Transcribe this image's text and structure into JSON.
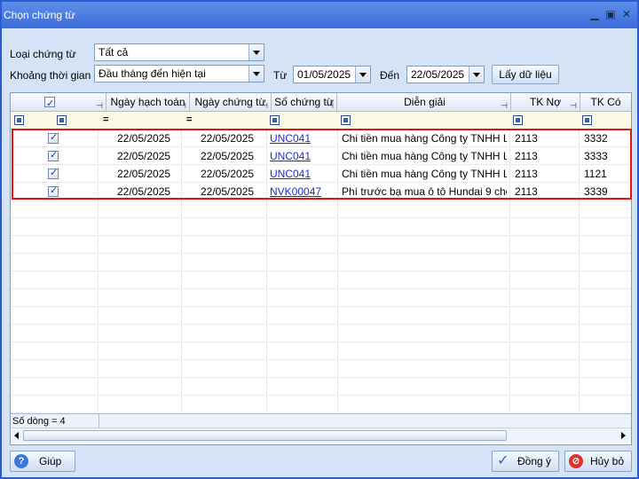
{
  "window": {
    "title": "Chọn chứng từ"
  },
  "filters": {
    "doc_type_label": "Loại chứng từ",
    "doc_type_value": "Tất cả",
    "period_label": "Khoảng thời gian",
    "period_value": "Đầu tháng đến hiện tại",
    "from_label": "Từ",
    "from_value": "01/05/2025",
    "to_label": "Đến",
    "to_value": "22/05/2025",
    "fetch_label": "Lấy dữ liệu"
  },
  "grid": {
    "columns": [
      "Ngày hạch toán",
      "Ngày chứng từ",
      "Số chứng từ",
      "Diễn giải",
      "TK Nợ",
      "TK Có"
    ],
    "rows": [
      {
        "checked": true,
        "posting_date": "22/05/2025",
        "doc_date": "22/05/2025",
        "doc_no": "UNC041",
        "description": "Chi tiền mua hàng Công ty TNHH L...",
        "debit": "2113",
        "credit": "3332"
      },
      {
        "checked": true,
        "posting_date": "22/05/2025",
        "doc_date": "22/05/2025",
        "doc_no": "UNC041",
        "description": "Chi tiền mua hàng Công ty TNHH L...",
        "debit": "2113",
        "credit": "3333"
      },
      {
        "checked": true,
        "posting_date": "22/05/2025",
        "doc_date": "22/05/2025",
        "doc_no": "UNC041",
        "description": "Chi tiền mua hàng Công ty TNHH L...",
        "debit": "2113",
        "credit": "1121"
      },
      {
        "checked": true,
        "posting_date": "22/05/2025",
        "doc_date": "22/05/2025",
        "doc_no": "NVK00047",
        "description": "Phí trước bạ mua ô tô Hundai 9 chỗ",
        "debit": "2113",
        "credit": "3339"
      }
    ],
    "row_count": "Số dòng = 4"
  },
  "buttons": {
    "help": "Giúp",
    "ok": "Đồng ý",
    "cancel": "Hủy bỏ"
  },
  "colors": {
    "accent": "#2b5bd6",
    "highlight_border": "#e01515",
    "link": "#1a2bd8"
  }
}
